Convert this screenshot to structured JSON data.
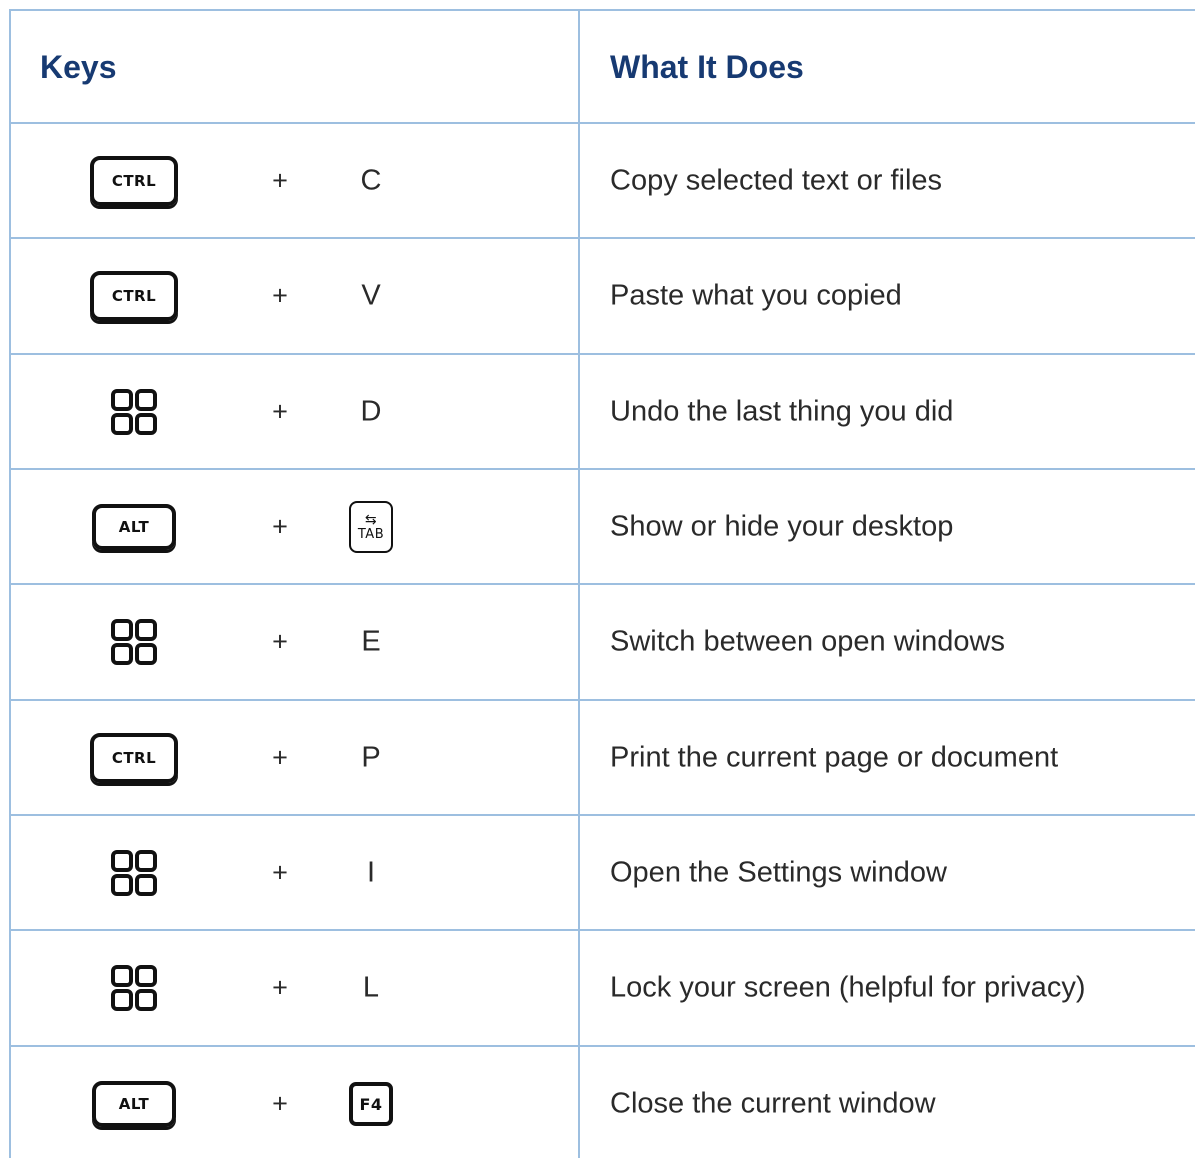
{
  "header": {
    "keys": "Keys",
    "what": "What It Does"
  },
  "rows": [
    {
      "modifier": "CTRL",
      "modifier_icon": "ctrl-key-icon",
      "plus": "+",
      "key": "C",
      "desc": "Copy selected text or files"
    },
    {
      "modifier": "CTRL",
      "modifier_icon": "ctrl-key-icon",
      "plus": "+",
      "key": "V",
      "desc": "Paste what you copied"
    },
    {
      "modifier": "",
      "modifier_icon": "windows-key-icon",
      "plus": "+",
      "key": "D",
      "desc": "Undo the last thing you did"
    },
    {
      "modifier": "ALT",
      "modifier_icon": "alt-key-icon",
      "plus": "+",
      "key": "TAB",
      "key_icon": "tab-key-icon",
      "desc": "Show or hide your desktop"
    },
    {
      "modifier": "",
      "modifier_icon": "windows-key-icon",
      "plus": "+",
      "key": "E",
      "desc": "Switch between open windows"
    },
    {
      "modifier": "CTRL",
      "modifier_icon": "ctrl-key-icon",
      "plus": "+",
      "key": "P",
      "desc": "Print the current page or document"
    },
    {
      "modifier": "",
      "modifier_icon": "windows-key-icon",
      "plus": "+",
      "key": "I",
      "desc": "Open the Settings window"
    },
    {
      "modifier": "",
      "modifier_icon": "windows-key-icon",
      "plus": "+",
      "key": "L",
      "desc": "Lock your screen (helpful for privacy)"
    },
    {
      "modifier": "ALT",
      "modifier_icon": "alt-key-icon",
      "plus": "+",
      "key": "F4",
      "key_icon": "f4-key-icon",
      "desc": "Close the current window"
    }
  ],
  "colors": {
    "header_text": "#173a72",
    "grid": "#9dbfe0",
    "body_text": "#2a2a2a"
  }
}
